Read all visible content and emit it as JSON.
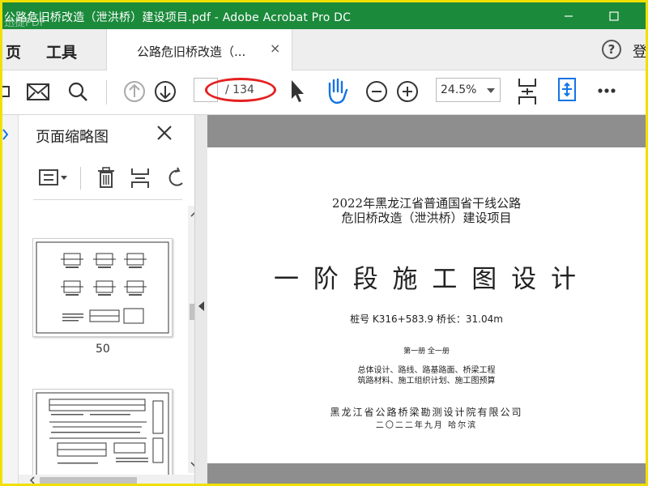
{
  "window": {
    "title": "公路危旧桥改造（泄洪桥）建设项目.pdf - Adobe Acrobat Pro DC",
    "watermark": "迅捷PDF",
    "minimize_icon": "minimize-icon",
    "maximize_icon": "maximize-icon",
    "titlebar_color": "#1b8a3b"
  },
  "menu": {
    "home_label": "页",
    "tools_label": "工具",
    "document_tab": "公路危旧桥改造（...",
    "close_tab": "×",
    "help": "?",
    "sign_in": "登"
  },
  "toolbar": {
    "icons": [
      "print-icon",
      "email-icon",
      "search-icon",
      "previous-page-icon",
      "next-page-icon",
      "select-tool-icon",
      "hand-tool-icon",
      "zoom-out-icon",
      "zoom-in-icon",
      "scrolling-mode-icon",
      "fit-page-icon",
      "more-icon"
    ],
    "current_page": "",
    "total_pages": "/ 134",
    "zoom": "24.5%",
    "annotation_color": "#e42020"
  },
  "sidebar": {
    "title": "页面缩略图",
    "thumbnails": [
      {
        "page_label": "50"
      },
      {
        "page_label": ""
      }
    ]
  },
  "document": {
    "title_line1": "2022年黑龙江省普通国省干线公路",
    "title_line2": "危旧桥改造（泄洪桥）建设项目",
    "main_title": "一 阶 段 施 工 图 设 计",
    "stake_info": "桩号 K316+583.9  桥长：31.04m",
    "volume_info": "第一册    全一册",
    "contents_line1": "总体设计、路线、路基路面、桥梁工程",
    "contents_line2": "筑路材料、施工组织计划、施工图预算",
    "company": "黑龙江省公路桥梁勘测设计院有限公司",
    "date_place": "二〇二二年九月  哈尔滨"
  }
}
